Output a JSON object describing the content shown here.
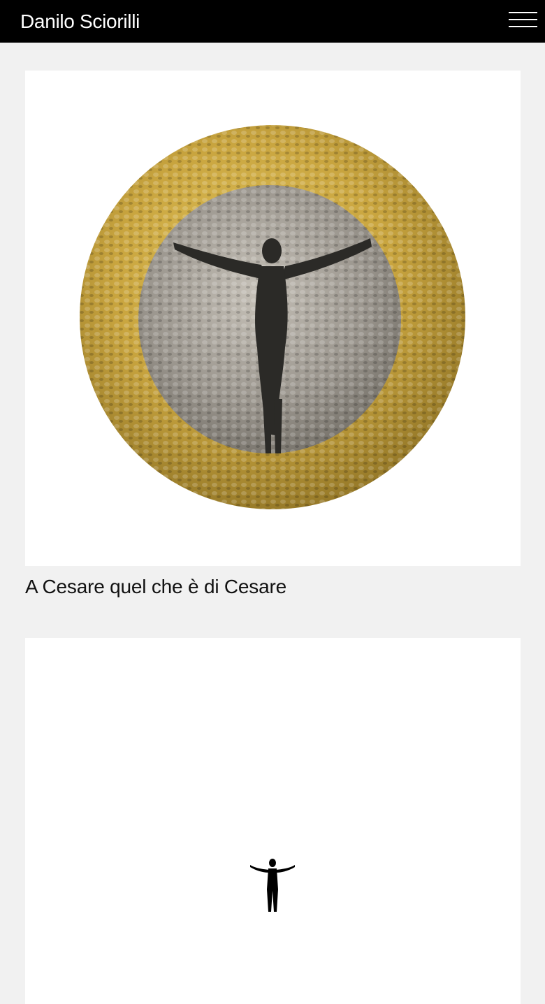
{
  "header": {
    "site_title": "Danilo Sciorilli",
    "menu_icon": "hamburger-menu-icon"
  },
  "works": [
    {
      "title": "A Cesare quel che è di Cesare",
      "image": "bimetallic-coin-crucifix-artwork"
    },
    {
      "title": "",
      "image": "small-crucifix-silhouette-artwork"
    }
  ],
  "colors": {
    "header_background": "#000000",
    "page_background": "#f1f1f1",
    "card_background": "#ffffff",
    "coin_gold": "#c9a53f",
    "coin_silver": "#9a958d"
  }
}
